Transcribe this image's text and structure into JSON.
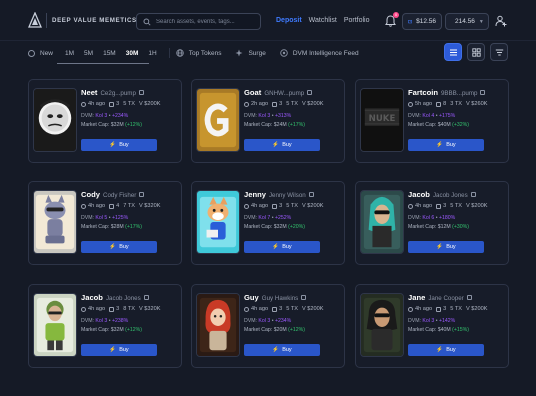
{
  "brand": {
    "name": "DEEP VALUE MEMETICS"
  },
  "search": {
    "placeholder": "Search assets, events, tags..."
  },
  "nav": {
    "items": [
      "Deposit",
      "Watchlist",
      "Portfolio"
    ],
    "active": "Deposit"
  },
  "notifications": {
    "count": "0"
  },
  "wallet": {
    "balance_usd": "$12.56",
    "balance_sol": "214.56"
  },
  "filters": {
    "new_label": "New",
    "timeframes": [
      "1M",
      "5M",
      "15M",
      "30M",
      "1H"
    ],
    "active_timeframe": "30M",
    "top_tokens": "Top Tokens",
    "surge": "Surge",
    "dvm_feed": "DVM Intelligence Feed"
  },
  "cards": [
    {
      "name": "Neet",
      "ticker": "Ce2g...pump",
      "age": "4h ago",
      "holders": "3",
      "tx": "5",
      "vol": "$200K",
      "kol": "Kol 3",
      "kol_change": "+234%",
      "market_cap": "$32M",
      "mc_change": "(+12%)",
      "buy": "Buy",
      "art": "neet"
    },
    {
      "name": "Goat",
      "ticker": "GNHW...pump",
      "age": "2h ago",
      "holders": "3",
      "tx": "5",
      "vol": "$200K",
      "kol": "Kol 3",
      "kol_change": "+313%",
      "market_cap": "$24M",
      "mc_change": "(+17%)",
      "buy": "Buy",
      "art": "goat"
    },
    {
      "name": "Fartcoin",
      "ticker": "9BBB...pump",
      "age": "5h ago",
      "holders": "8",
      "tx": "3",
      "vol": "$260K",
      "kol": "Kol 4",
      "kol_change": "+175%",
      "market_cap": "$40M",
      "mc_change": "(+32%)",
      "buy": "Buy",
      "art": "fart"
    },
    {
      "name": "Cody",
      "ticker": "Cody Fisher",
      "age": "4h ago",
      "holders": "4",
      "tx": "7",
      "vol": "$320K",
      "kol": "Kol 5",
      "kol_change": "+125%",
      "market_cap": "$28M",
      "mc_change": "(+17%)",
      "buy": "Buy",
      "art": "cody"
    },
    {
      "name": "Jenny",
      "ticker": "Jenny Wilson",
      "age": "4h ago",
      "holders": "3",
      "tx": "5",
      "vol": "$200K",
      "kol": "Kol 7",
      "kol_change": "+252%",
      "market_cap": "$32M",
      "mc_change": "(+20%)",
      "buy": "Buy",
      "art": "jenny"
    },
    {
      "name": "Jacob",
      "ticker": "Jacob Jones",
      "age": "4h ago",
      "holders": "3",
      "tx": "5",
      "vol": "$200K",
      "kol": "Kol 6",
      "kol_change": "+180%",
      "market_cap": "$12M",
      "mc_change": "(+30%)",
      "buy": "Buy",
      "art": "jacob1"
    },
    {
      "name": "Jacob",
      "ticker": "Jacob Jones",
      "age": "4h ago",
      "holders": "3",
      "tx": "8",
      "vol": "$320K",
      "kol": "Kol 3",
      "kol_change": "+238%",
      "market_cap": "$32M",
      "mc_change": "(+12%)",
      "buy": "Buy",
      "art": "jacob2"
    },
    {
      "name": "Guy",
      "ticker": "Guy Hawkins",
      "age": "4h ago",
      "holders": "3",
      "tx": "5",
      "vol": "$200K",
      "kol": "Kol 3",
      "kol_change": "+234%",
      "market_cap": "$20M",
      "mc_change": "(+12%)",
      "buy": "Buy",
      "art": "guy"
    },
    {
      "name": "Jane",
      "ticker": "Jane Cooper",
      "age": "4h ago",
      "holders": "3",
      "tx": "5",
      "vol": "$200K",
      "kol": "Kol 3",
      "kol_change": "+142%",
      "market_cap": "$40M",
      "mc_change": "(+15%)",
      "buy": "Buy",
      "art": "jane"
    }
  ],
  "labels": {
    "dvm": "DVM:",
    "market_cap": "Market Cap:",
    "tx": "TX",
    "vol_prefix": "V"
  },
  "colors": {
    "accent": "#2a56c9",
    "kol": "#9b59ff",
    "positive": "#33c26e",
    "background": "#151a26"
  }
}
